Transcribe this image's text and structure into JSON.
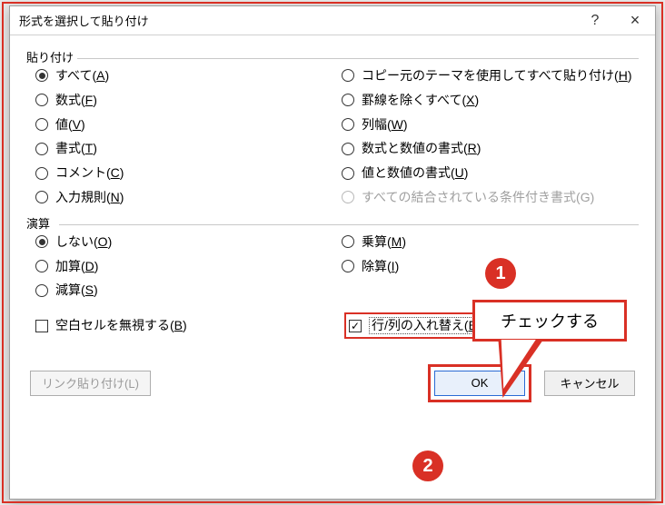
{
  "window": {
    "title": "形式を選択して貼り付け",
    "help_tooltip": "?",
    "close_tooltip": "×"
  },
  "groups": {
    "paste": "貼り付け",
    "operation": "演算"
  },
  "paste_options": {
    "all": {
      "label": "すべて",
      "accel": "A",
      "selected": true,
      "disabled": false
    },
    "formulas": {
      "label": "数式",
      "accel": "F",
      "selected": false,
      "disabled": false
    },
    "values": {
      "label": "値",
      "accel": "V",
      "selected": false,
      "disabled": false
    },
    "formats": {
      "label": "書式",
      "accel": "T",
      "selected": false,
      "disabled": false
    },
    "comments": {
      "label": "コメント",
      "accel": "C",
      "selected": false,
      "disabled": false
    },
    "validation": {
      "label": "入力規則",
      "accel": "N",
      "selected": false,
      "disabled": false
    },
    "theme": {
      "label": "コピー元のテーマを使用してすべて貼り付け",
      "accel": "H",
      "selected": false,
      "disabled": false
    },
    "noborders": {
      "label": "罫線を除くすべて",
      "accel": "X",
      "selected": false,
      "disabled": false
    },
    "colwidth": {
      "label": "列幅",
      "accel": "W",
      "selected": false,
      "disabled": false
    },
    "fn_formats": {
      "label": "数式と数値の書式",
      "accel": "R",
      "selected": false,
      "disabled": false
    },
    "val_formats": {
      "label": "値と数値の書式",
      "accel": "U",
      "selected": false,
      "disabled": false
    },
    "merge_cond": {
      "label": "すべての結合されている条件付き書式",
      "accel": "G",
      "selected": false,
      "disabled": true
    }
  },
  "operation_options": {
    "none": {
      "label": "しない",
      "accel": "O",
      "selected": true
    },
    "add": {
      "label": "加算",
      "accel": "D",
      "selected": false
    },
    "sub": {
      "label": "減算",
      "accel": "S",
      "selected": false
    },
    "mul": {
      "label": "乗算",
      "accel": "M",
      "selected": false
    },
    "div": {
      "label": "除算",
      "accel": "I",
      "selected": false
    }
  },
  "checks": {
    "skip_blanks": {
      "label": "空白セルを無視する",
      "accel": "B",
      "checked": false
    },
    "transpose": {
      "label": "行/列の入れ替え",
      "accel": "E",
      "checked": true
    }
  },
  "buttons": {
    "paste_link": {
      "label": "リンク貼り付け",
      "accel": "L",
      "enabled": false
    },
    "ok": "OK",
    "cancel": "キャンセル"
  },
  "annotations": {
    "bubble": "チェックする",
    "badge1": "1",
    "badge2": "2",
    "highlight_color": "#d93025"
  }
}
